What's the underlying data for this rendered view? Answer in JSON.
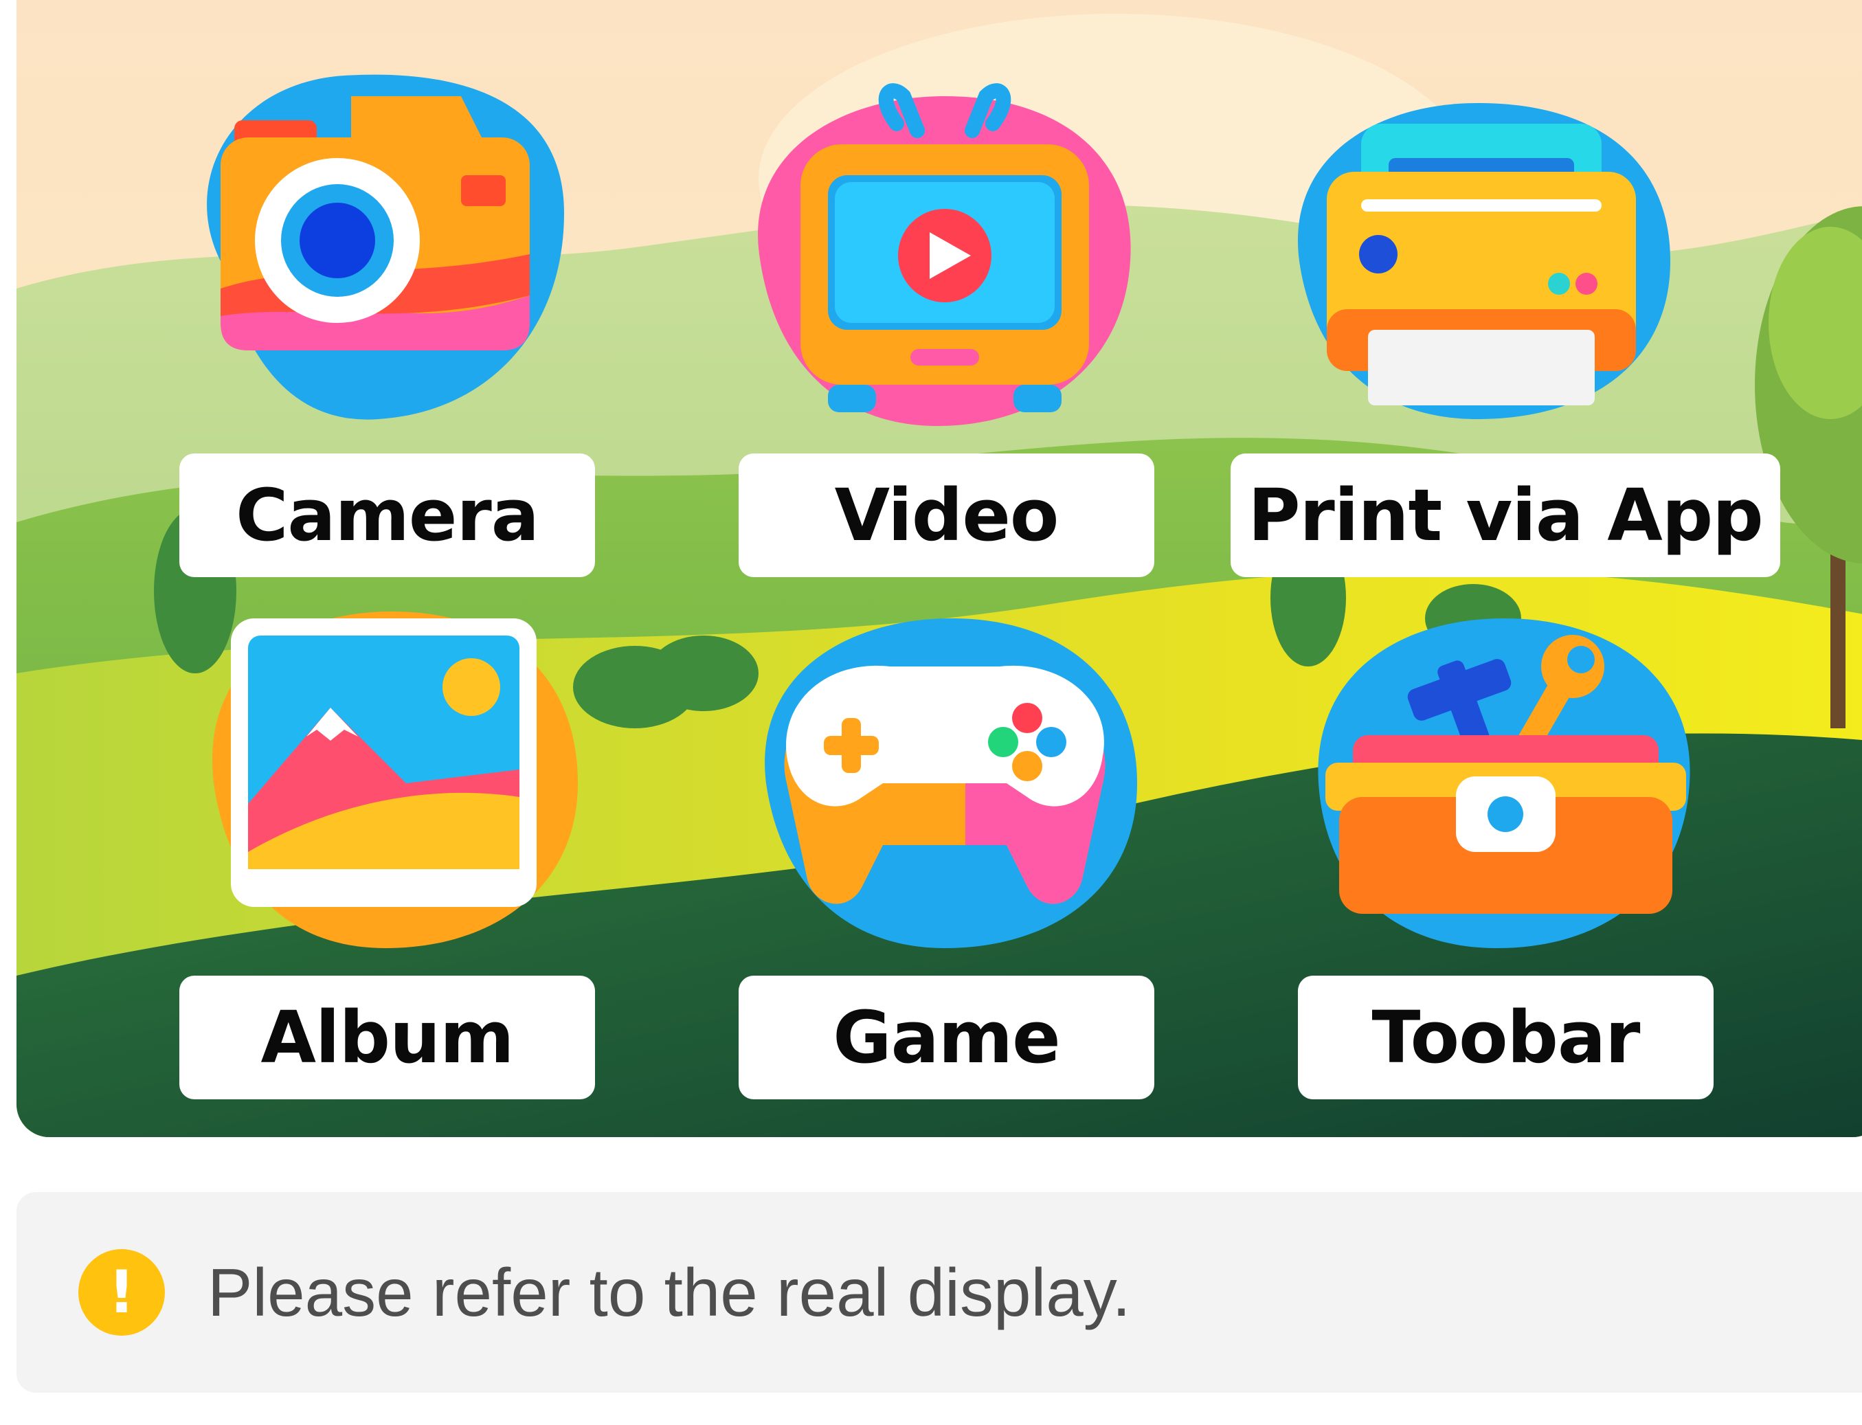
{
  "apps": [
    {
      "name": "camera",
      "label": "Camera"
    },
    {
      "name": "video",
      "label": "Video"
    },
    {
      "name": "print",
      "label": "Print via App"
    },
    {
      "name": "album",
      "label": "Album"
    },
    {
      "name": "game",
      "label": "Game"
    },
    {
      "name": "toolbar",
      "label": "Toobar"
    }
  ],
  "icons": {
    "camera": "camera-icon",
    "video": "tv-play-icon",
    "print": "printer-icon",
    "album": "photo-icon",
    "game": "gamepad-icon",
    "toolbar": "toolbox-icon",
    "notice": "exclamation-icon"
  },
  "colors": {
    "icon_blue": "#1fa8ee",
    "icon_orange": "#ffa41b",
    "icon_pink": "#ff5aa8",
    "notice_yellow": "#ffc20e",
    "notice_bg": "#f3f3f3"
  },
  "notice": {
    "icon_glyph": "!",
    "text": "Please refer to the real display."
  }
}
